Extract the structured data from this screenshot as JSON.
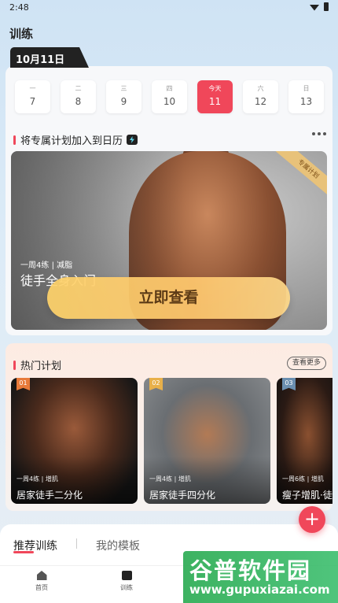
{
  "status_bar": {
    "time": "2:48"
  },
  "page_title": "训练",
  "date_tab": "10月11日",
  "week": [
    {
      "weekday": "一",
      "date": "7",
      "today": false
    },
    {
      "weekday": "二",
      "date": "8",
      "today": false
    },
    {
      "weekday": "三",
      "date": "9",
      "today": false
    },
    {
      "weekday": "四",
      "date": "10",
      "today": false
    },
    {
      "weekday": "今天",
      "date": "11",
      "today": true
    },
    {
      "weekday": "六",
      "date": "12",
      "today": false
    },
    {
      "weekday": "日",
      "date": "13",
      "today": false
    }
  ],
  "calendar_section": {
    "title": "将专属计划加入到日历"
  },
  "hero": {
    "ribbon": "专属计划",
    "meta_freq": "一周4练",
    "meta_goal": "减脂",
    "name": "徒手全身入门",
    "cta": "立即查看"
  },
  "hot_section": {
    "title": "热门计划",
    "see_more": "查看更多"
  },
  "plans": [
    {
      "rank": "01",
      "freq": "一周4练",
      "goal": "增肌",
      "name": "居家徒手二分化"
    },
    {
      "rank": "02",
      "freq": "一周4练",
      "goal": "增肌",
      "name": "居家徒手四分化"
    },
    {
      "rank": "03",
      "freq": "一周6练",
      "goal": "增肌",
      "name": "瘦子增肌·徒手"
    }
  ],
  "fab_label": "+",
  "bottom_tabs": {
    "recommended": "推荐训练",
    "mine": "我的模板"
  },
  "nav": {
    "home": "首页",
    "train": "训练"
  },
  "watermark": {
    "title": "谷普软件园",
    "url": "www.gupuxiazai.com"
  },
  "colors": {
    "accent": "#f0475a",
    "cta": "#ffd36a"
  },
  "icons": [
    "wifi-icon",
    "battery-icon",
    "lightning-icon",
    "more-icon",
    "plus-icon",
    "home-icon",
    "train-icon"
  ]
}
